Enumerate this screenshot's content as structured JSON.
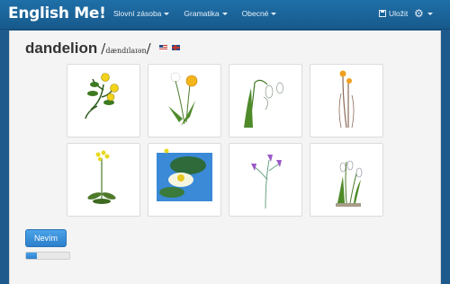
{
  "brand": "English Me!",
  "nav": {
    "items": [
      {
        "label": "Slovní zásoba"
      },
      {
        "label": "Gramatika"
      },
      {
        "label": "Obecné"
      }
    ],
    "save_label": "Uložit"
  },
  "exercise": {
    "word": "dandelion",
    "ipa": "dændɪlaɪən",
    "flags": [
      "us-flag",
      "uk-flag"
    ],
    "images": [
      {
        "name": "buttercup"
      },
      {
        "name": "dandelion"
      },
      {
        "name": "snowdrop"
      },
      {
        "name": "coltsfoot"
      },
      {
        "name": "cowslip"
      },
      {
        "name": "water-lily"
      },
      {
        "name": "harebell"
      },
      {
        "name": "snowflake"
      }
    ],
    "button_label": "Nevím",
    "progress": 0.25
  },
  "colors": {
    "navbar": "#1f6fa8",
    "accent": "#2d7fcc",
    "background": "#f4f4f4"
  }
}
